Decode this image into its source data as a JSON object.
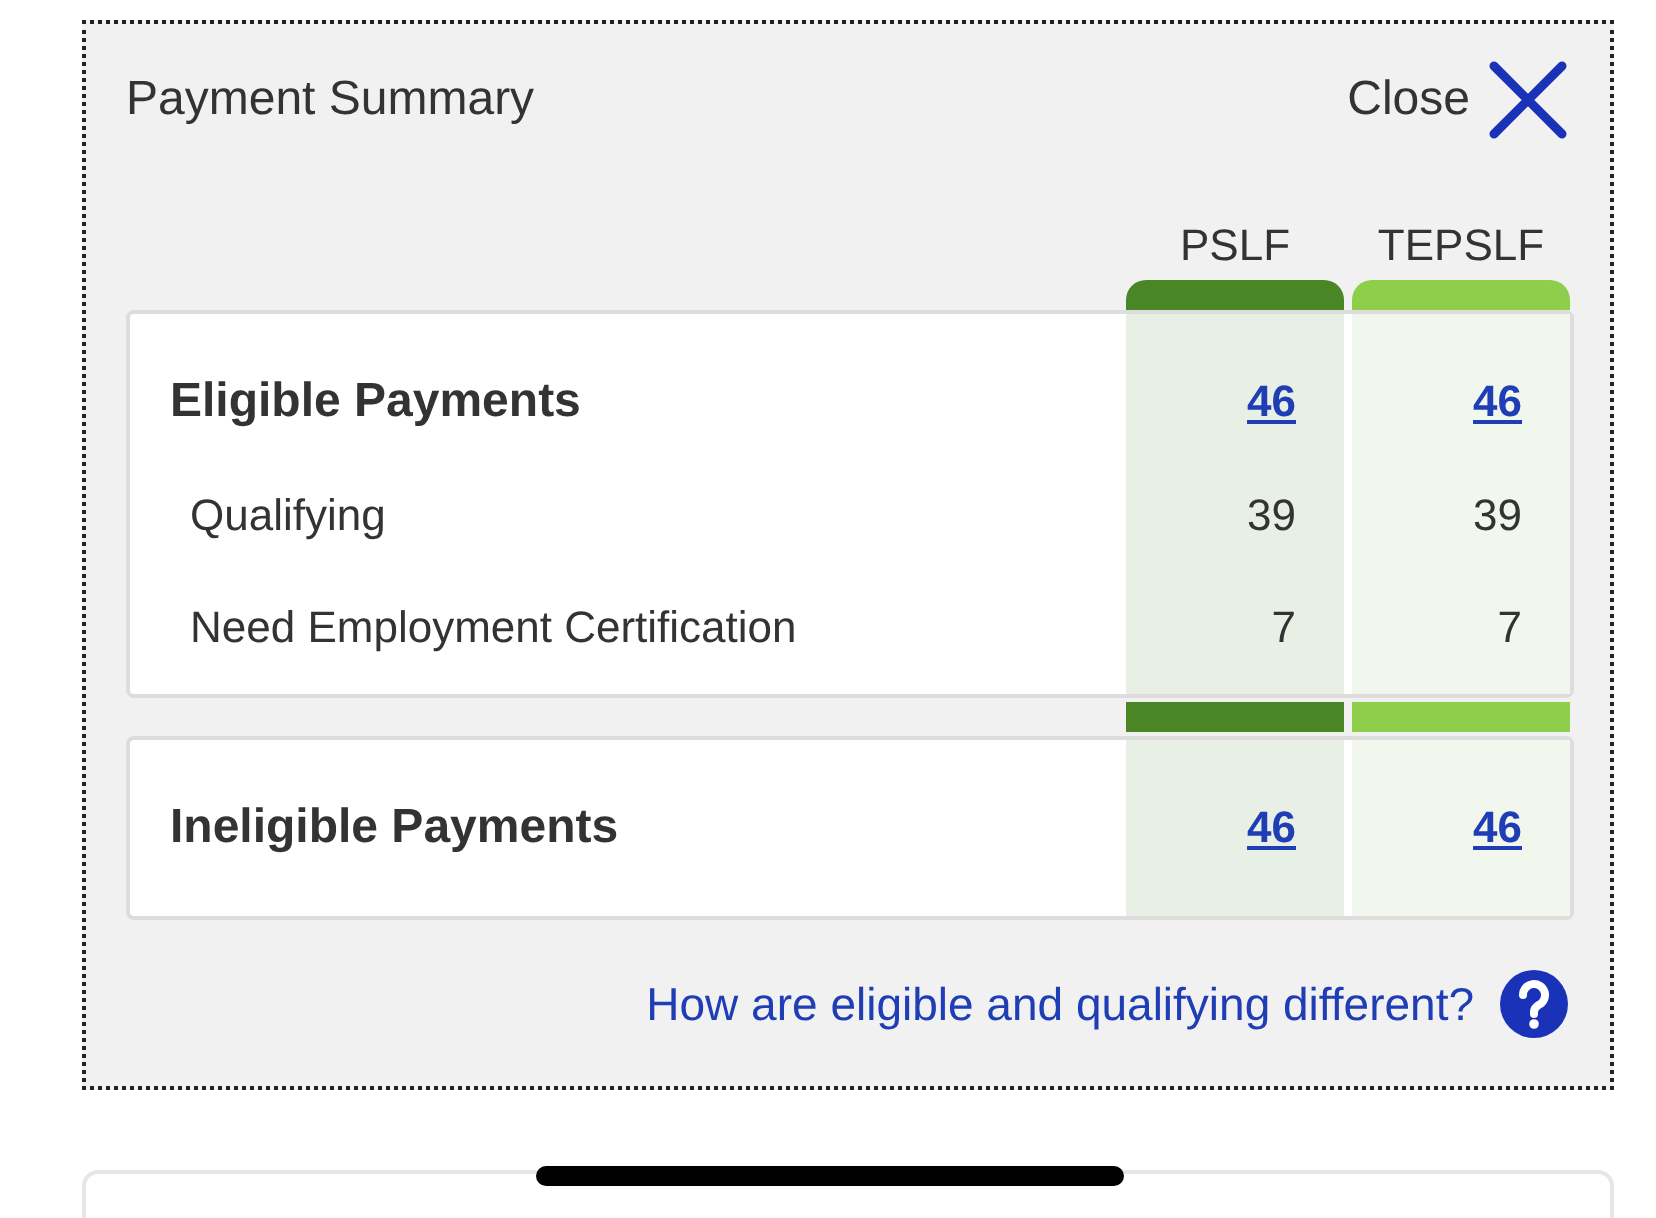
{
  "panel": {
    "title": "Payment Summary",
    "close_label": "Close"
  },
  "columns": [
    {
      "label": "PSLF",
      "color": "#4a8526"
    },
    {
      "label": "TEPSLF",
      "color": "#8fce4a"
    }
  ],
  "sections": [
    {
      "title": "Eligible Payments",
      "values": [
        "46",
        "46"
      ],
      "rows": [
        {
          "label": "Qualifying",
          "values": [
            "39",
            "39"
          ]
        },
        {
          "label": "Need Employment Certification",
          "values": [
            "7",
            "7"
          ]
        }
      ]
    },
    {
      "title": "Ineligible Payments",
      "values": [
        "46",
        "46"
      ]
    }
  ],
  "help_link": "How are eligible and qualifying different?"
}
